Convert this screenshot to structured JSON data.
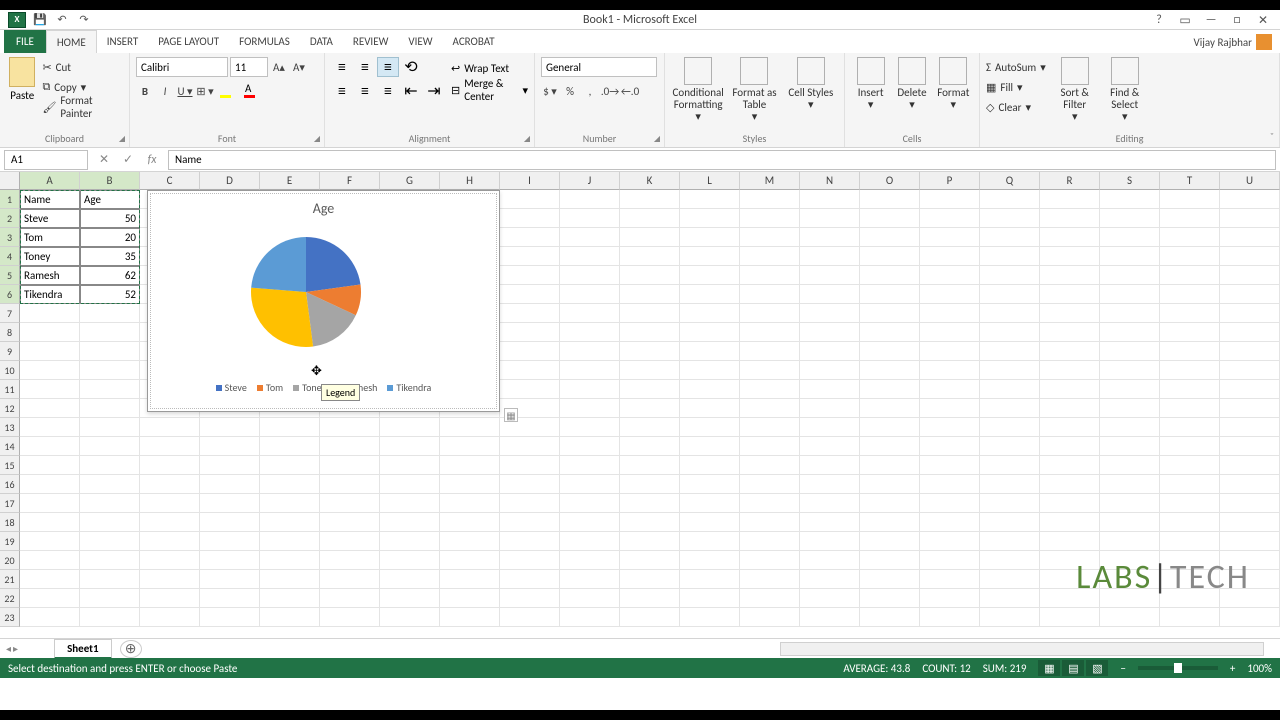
{
  "window": {
    "title": "Book1 - Microsoft Excel",
    "user": "Vijay Rajbhar"
  },
  "qat": {
    "app": "X"
  },
  "tabs": {
    "file": "FILE",
    "home": "HOME",
    "insert": "INSERT",
    "pagelayout": "PAGE LAYOUT",
    "formulas": "FORMULAS",
    "data": "DATA",
    "review": "REVIEW",
    "view": "VIEW",
    "acrobat": "ACROBAT"
  },
  "ribbon": {
    "clipboard": {
      "paste": "Paste",
      "cut": "Cut",
      "copy": "Copy",
      "fmtpainter": "Format Painter",
      "label": "Clipboard"
    },
    "font": {
      "name": "Calibri",
      "size": "11",
      "label": "Font"
    },
    "alignment": {
      "wrap": "Wrap Text",
      "merge": "Merge & Center",
      "label": "Alignment"
    },
    "number": {
      "format": "General",
      "label": "Number"
    },
    "styles": {
      "cond": "Conditional Formatting",
      "fmttable": "Format as Table",
      "cellstyles": "Cell Styles",
      "label": "Styles"
    },
    "cells": {
      "insert": "Insert",
      "delete": "Delete",
      "format": "Format",
      "label": "Cells"
    },
    "editing": {
      "autosum": "AutoSum",
      "fill": "Fill",
      "clear": "Clear",
      "sort": "Sort & Filter",
      "find": "Find & Select",
      "label": "Editing"
    }
  },
  "formula_bar": {
    "namebox": "A1",
    "formula": "Name"
  },
  "columns": [
    "A",
    "B",
    "C",
    "D",
    "E",
    "F",
    "G",
    "H",
    "I",
    "J",
    "K",
    "L",
    "M",
    "N",
    "O",
    "P",
    "Q",
    "R",
    "S",
    "T",
    "U"
  ],
  "rows": [
    "1",
    "2",
    "3",
    "4",
    "5",
    "6",
    "7",
    "8",
    "9",
    "10",
    "11",
    "12",
    "13",
    "14",
    "15",
    "16",
    "17",
    "18",
    "19",
    "20",
    "21",
    "22",
    "23"
  ],
  "table": {
    "header": [
      "Name",
      "Age"
    ],
    "rows": [
      {
        "name": "Steve",
        "age": "50"
      },
      {
        "name": "Tom",
        "age": "20"
      },
      {
        "name": "Toney",
        "age": "35"
      },
      {
        "name": "Ramesh",
        "age": "62"
      },
      {
        "name": "Tikendra",
        "age": "52"
      }
    ]
  },
  "chart": {
    "title": "Age",
    "tooltip": "Legend"
  },
  "chart_data": {
    "type": "pie",
    "title": "Age",
    "categories": [
      "Steve",
      "Tom",
      "Toney",
      "Ramesh",
      "Tikendra"
    ],
    "values": [
      50,
      20,
      35,
      62,
      52
    ],
    "colors": [
      "#4472C4",
      "#ED7D31",
      "#A5A5A5",
      "#FFC000",
      "#5B9BD5"
    ],
    "legend_position": "bottom"
  },
  "sheets": {
    "active": "Sheet1"
  },
  "status": {
    "msg": "Select destination and press ENTER or choose Paste",
    "avg": "AVERAGE: 43.8",
    "count": "COUNT: 12",
    "sum": "SUM: 219",
    "zoom": "100%"
  },
  "watermark": {
    "labs": "LABS",
    "tech": "TECH"
  }
}
